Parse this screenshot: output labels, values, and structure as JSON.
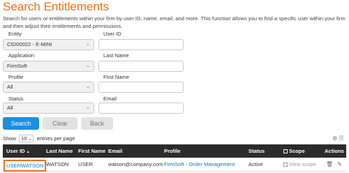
{
  "page": {
    "title": "Search Entitlements",
    "description": "Search for users or entitlements within your firm by user ID, name, email, and more. This function allows you to find a specific user within your firm and then adjust their entitlements and permissions."
  },
  "form": {
    "entity_label": "Entity",
    "entity_value": "CID00022 - E-MINI",
    "application_label": "Application",
    "application_value": "FirmSoft",
    "profile_label": "Profile",
    "profile_value": "All",
    "status_label": "Status",
    "status_value": "All",
    "userid_label": "User ID",
    "userid_value": "",
    "lastname_label": "Last Name",
    "lastname_value": "",
    "firstname_label": "First Name",
    "firstname_value": "",
    "email_label": "Email",
    "email_value": ""
  },
  "buttons": {
    "search": "Search",
    "clear": "Clear",
    "back": "Back"
  },
  "paging": {
    "show_label": "Show",
    "page_size": "10",
    "entries_label": "entries per page"
  },
  "table": {
    "headers": {
      "user_id": "User ID",
      "sort_icon": "▲",
      "last_name": "Last Name",
      "first_name": "First Name",
      "email": "Email",
      "profile": "Profile",
      "status": "Status",
      "scope": "Scope",
      "actions": "Actions"
    },
    "rows": [
      {
        "user_id": "USERWATSON",
        "last_name": "WATSON",
        "first_name": "USER",
        "email": "watson@company.com",
        "profile_app": "FirmSoft",
        "profile_sep": "-",
        "profile_name": "Order Management",
        "status": "Active",
        "scope": "View scope"
      }
    ]
  },
  "icons": {
    "select_chevron": "chevron-down-icon",
    "settings": "gear-icon",
    "export": "export-icon",
    "scope": "scope-icon",
    "delete": "trash-icon",
    "edit": "edit-icon"
  },
  "colors": {
    "title": "#e8721c",
    "primary": "#1b8fe0",
    "header_bg": "#2b2b2b",
    "link": "#1b6fc2",
    "highlight": "#e8721c"
  }
}
